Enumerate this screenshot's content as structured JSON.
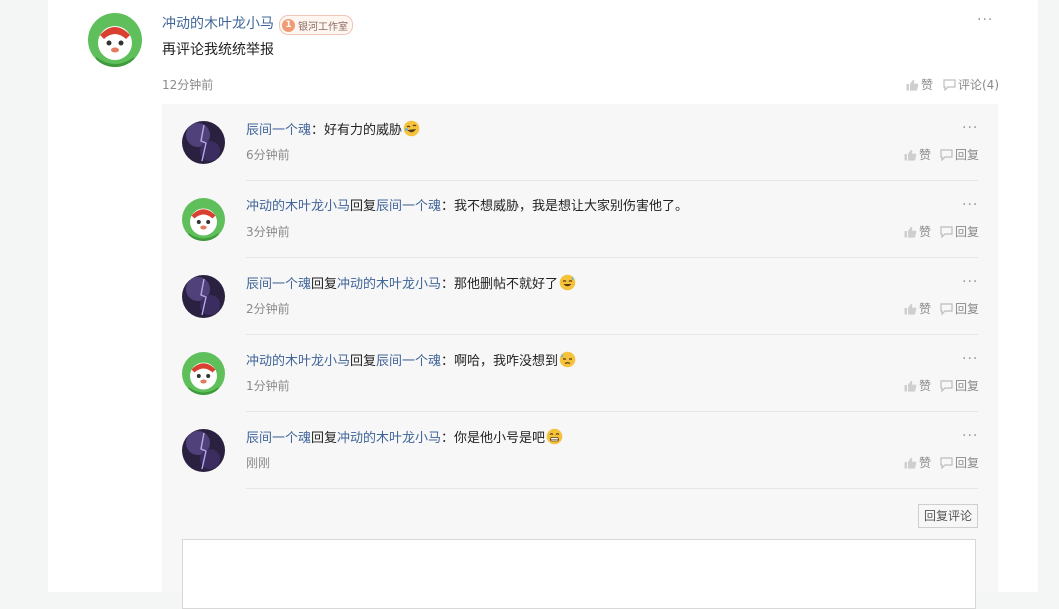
{
  "main_comment": {
    "author": "冲动的木叶龙小马",
    "badge_level": "1",
    "badge_text": "银河工作室",
    "text": "再评论我统统举报",
    "time": "12分钟前",
    "like_label": "赞",
    "comment_label": "评论(4)",
    "more_label": "···"
  },
  "replies": [
    {
      "author": "辰间一个魂",
      "reply_word": "",
      "target": "",
      "text": "：好有力的威胁",
      "emoji": "rofl-emoji",
      "time": "6分钟前"
    },
    {
      "author": "冲动的木叶龙小马",
      "reply_word": "回复",
      "target": "辰间一个魂",
      "text": "：我不想威胁，我是想让大家别伤害他了。",
      "emoji": "",
      "time": "3分钟前"
    },
    {
      "author": "辰间一个魂",
      "reply_word": "回复",
      "target": "冲动的木叶龙小马",
      "text": "：那他删帖不就好了",
      "emoji": "sweat-smile-emoji",
      "time": "2分钟前"
    },
    {
      "author": "冲动的木叶龙小马",
      "reply_word": "回复",
      "target": "辰间一个魂",
      "text": "：啊哈，我咋没想到",
      "emoji": "downcast-sweat-emoji",
      "time": "1分钟前"
    },
    {
      "author": "辰间一个魂",
      "reply_word": "回复",
      "target": "冲动的木叶龙小马",
      "text": "：你是他小号是吧",
      "emoji": "grimace-emoji",
      "time": "刚刚"
    }
  ],
  "reply_actions": {
    "like_label": "赞",
    "reply_label": "回复",
    "more_label": "···"
  },
  "reply_comment_button": "回复评论",
  "colors": {
    "username": "#406599",
    "meta_text": "#8a8a8a",
    "reply_bg": "#f7f7f7"
  }
}
